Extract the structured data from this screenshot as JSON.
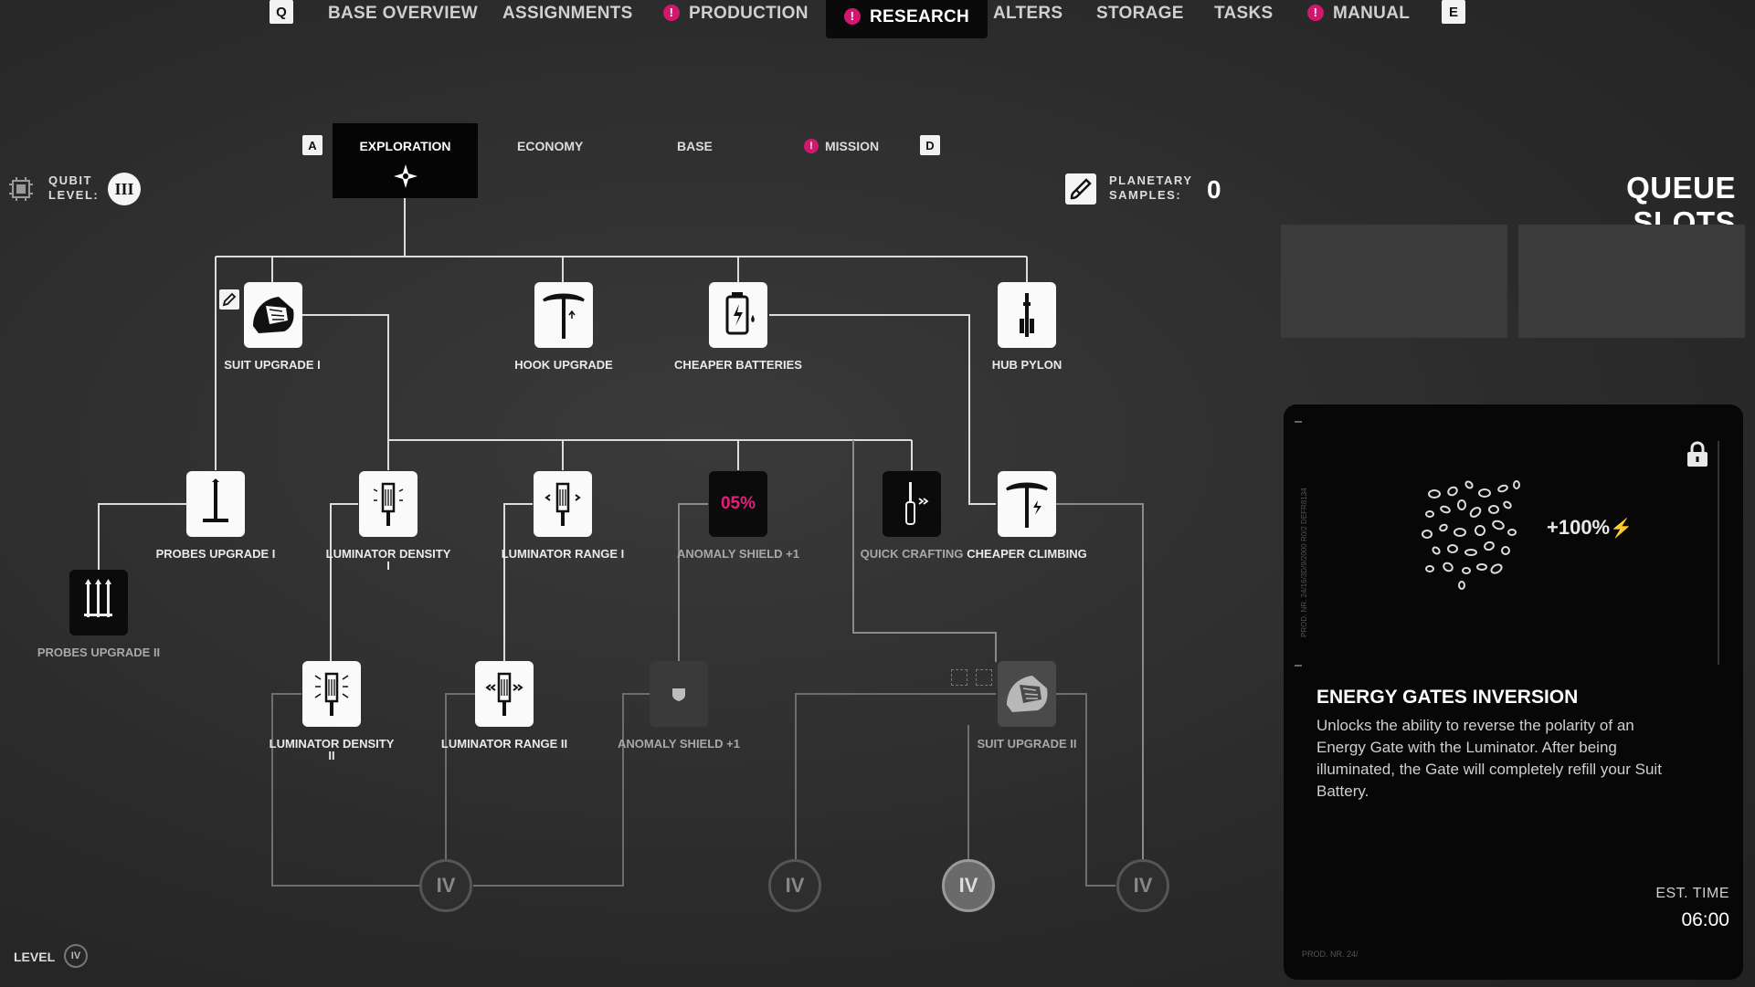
{
  "nav": {
    "key_left": "Q",
    "key_right": "E",
    "alert_glyph": "!",
    "tabs": [
      {
        "label": "BASE OVERVIEW"
      },
      {
        "label": "ASSIGNMENTS"
      },
      {
        "label": "PRODUCTION",
        "alert": true
      },
      {
        "label": "RESEARCH",
        "alert": true,
        "active": true
      },
      {
        "label": "ALTERS"
      },
      {
        "label": "STORAGE"
      },
      {
        "label": "TASKS"
      },
      {
        "label": "MANUAL",
        "alert": true
      }
    ]
  },
  "subnav": {
    "key_left": "A",
    "key_right": "D",
    "tabs": [
      {
        "label": "EXPLORATION",
        "active": true
      },
      {
        "label": "ECONOMY"
      },
      {
        "label": "BASE"
      },
      {
        "label": "MISSION",
        "alert": true
      }
    ]
  },
  "qubit": {
    "label_line1": "QUBIT",
    "label_line2": "LEVEL:",
    "value": "III"
  },
  "samples": {
    "label_line1": "PLANETARY",
    "label_line2": "SAMPLES:",
    "value": "0"
  },
  "queue": {
    "title": "QUEUE SLOTS"
  },
  "tree": {
    "row1": [
      {
        "label": "SUIT UPGRADE I"
      },
      {
        "label": "HOOK UPGRADE"
      },
      {
        "label": "CHEAPER BATTERIES"
      },
      {
        "label": "HUB PYLON"
      }
    ],
    "row2": [
      {
        "label": "PROBES UPGRADE I"
      },
      {
        "label": "LUMINATOR DENSITY I"
      },
      {
        "label": "LUMINATOR RANGE I"
      },
      {
        "label": "ANOMALY SHIELD +1",
        "value_text": "05%"
      },
      {
        "label": "QUICK CRAFTING"
      },
      {
        "label": "CHEAPER CLIMBING"
      }
    ],
    "probes2": {
      "label": "PROBES UPGRADE II"
    },
    "row3": [
      {
        "label": "LUMINATOR DENSITY II"
      },
      {
        "label": "LUMINATOR RANGE II"
      },
      {
        "label": "ANOMALY SHIELD +1"
      },
      {
        "label": "SUIT UPGRADE II"
      }
    ],
    "level_nodes": [
      "IV",
      "IV",
      "IV",
      "IV"
    ]
  },
  "level": {
    "label": "LEVEL",
    "value": "IV"
  },
  "detail": {
    "bonus": "+100%",
    "title": "ENERGY GATES INVERSION",
    "description": "Unlocks the ability to reverse the polarity of an Energy Gate with the Luminator. After being illuminated, the Gate will completely refill your Suit Battery.",
    "est_label": "EST. TIME",
    "est_value": "06:00",
    "side_code": "PROD. NR. 24/16/3D/9/2000 R0/2  DEFR8134",
    "footer_code": "PROD. NR. 24/"
  }
}
